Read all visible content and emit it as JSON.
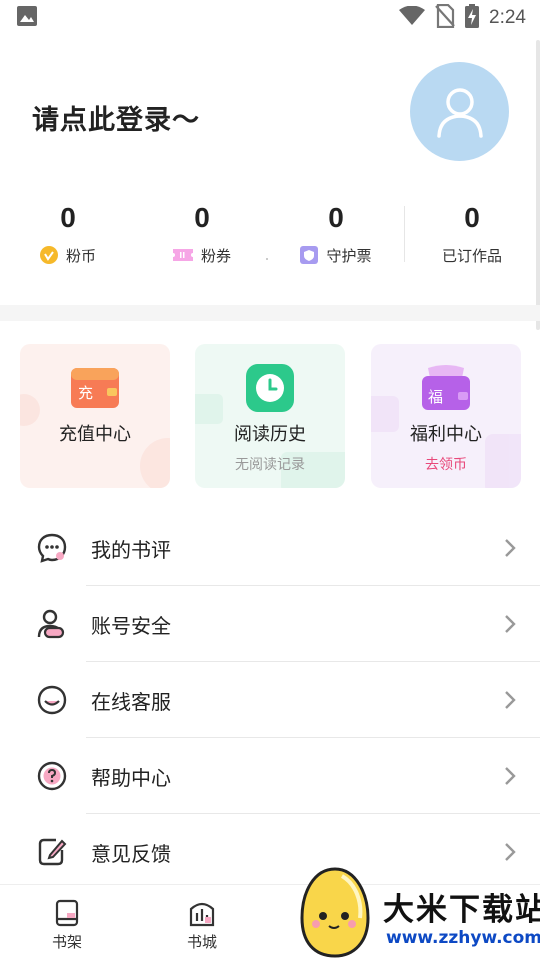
{
  "status_bar": {
    "time": "2:24",
    "icons": [
      "image-notification-icon",
      "wifi-icon",
      "no-sim-icon",
      "battery-charging-icon"
    ]
  },
  "header": {
    "login_prompt": "请点此登录～",
    "avatar_icon": "user-icon"
  },
  "stats": [
    {
      "value": "0",
      "label": "粉币",
      "icon": "coin-icon"
    },
    {
      "value": "0",
      "label": "粉券",
      "icon": "ticket-icon"
    },
    {
      "value": "0",
      "label": "守护票",
      "icon": "guard-ticket-icon"
    },
    {
      "value": "0",
      "label": "已订作品",
      "icon": ""
    }
  ],
  "cards": [
    {
      "title": "充值中心",
      "subtitle": "",
      "icon": "recharge-card-icon",
      "icon_text": "充",
      "accent": "#f2655a"
    },
    {
      "title": "阅读历史",
      "subtitle": "无阅读记录",
      "icon": "clock-icon",
      "accent": "#28c987"
    },
    {
      "title": "福利中心",
      "subtitle": "去领币",
      "icon": "gift-bag-icon",
      "icon_text": "福",
      "accent": "#b35de3",
      "subtitle_color": "#e8487a"
    }
  ],
  "menu": [
    {
      "label": "我的书评",
      "icon": "comment-bubble-icon"
    },
    {
      "label": "账号安全",
      "icon": "account-security-icon"
    },
    {
      "label": "在线客服",
      "icon": "customer-service-icon"
    },
    {
      "label": "帮助中心",
      "icon": "help-icon"
    },
    {
      "label": "意见反馈",
      "icon": "feedback-edit-icon"
    }
  ],
  "bottom_nav": [
    {
      "label": "书架",
      "icon": "bookshelf-icon"
    },
    {
      "label": "书城",
      "icon": "bookstore-icon"
    }
  ],
  "watermark": {
    "title": "大米下载站",
    "url": "www.zzhyw.com"
  },
  "colors": {
    "avatar_bg": "#b9d9f2",
    "text_primary": "#222222",
    "link_pink": "#e8487a",
    "watermark_blue": "#0d49c4"
  }
}
